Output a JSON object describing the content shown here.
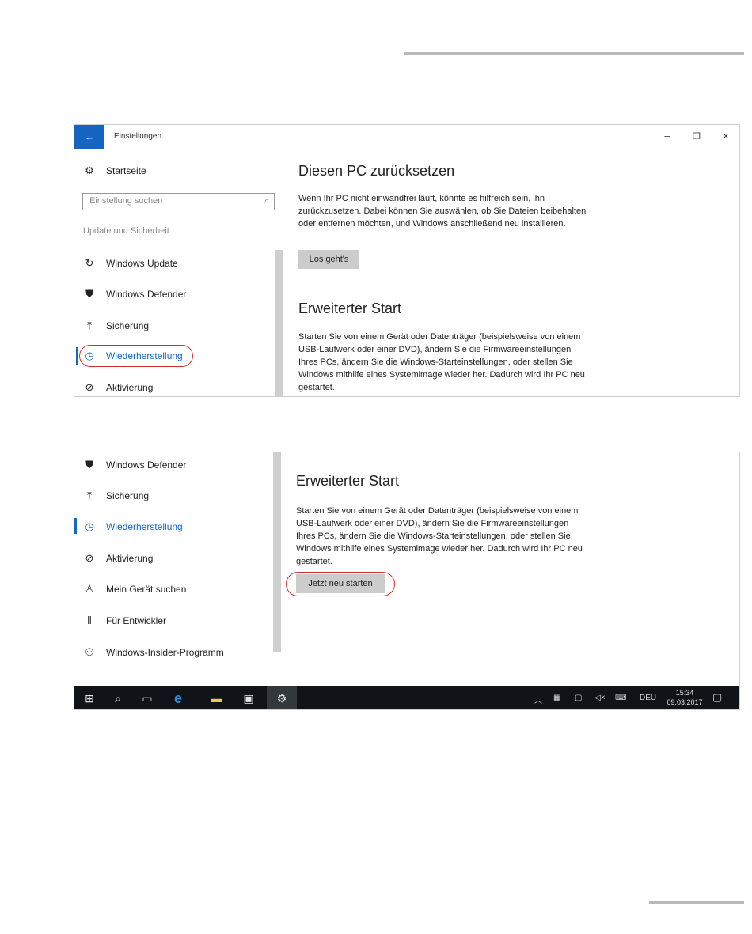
{
  "window": {
    "back_glyph": "←",
    "title": "Einstellungen",
    "minimize": "–",
    "maximize": "❐",
    "close": "✕"
  },
  "sidebar": {
    "home_label": "Startseite",
    "search_placeholder": "Einstellung suchen",
    "group_label": "Update und Sicherheit",
    "items": [
      {
        "label": "Windows Update",
        "icon": "refresh-icon"
      },
      {
        "label": "Windows Defender",
        "icon": "shield-icon"
      },
      {
        "label": "Sicherung",
        "icon": "backup-arrow-icon"
      },
      {
        "label": "Wiederherstellung",
        "icon": "history-icon"
      },
      {
        "label": "Aktivierung",
        "icon": "check-circle-icon"
      },
      {
        "label": "Mein Gerät suchen",
        "icon": "person-pin-icon"
      },
      {
        "label": "Für Entwickler",
        "icon": "tools-icon"
      },
      {
        "label": "Windows-Insider-Programm",
        "icon": "insider-icon"
      }
    ]
  },
  "reset": {
    "title": "Diesen PC zurücksetzen",
    "text": "Wenn Ihr PC nicht einwandfrei läuft, könnte es hilfreich sein, ihn zurückzusetzen. Dabei können Sie auswählen, ob Sie Dateien beibehalten oder entfernen möchten, und Windows anschließend neu installieren.",
    "button": "Los geht's"
  },
  "advanced": {
    "title": "Erweiterter Start",
    "text": "Starten Sie von einem Gerät oder Datenträger (beispielsweise von einem USB-Laufwerk oder einer DVD), ändern Sie die Firmwareeinstellungen Ihres PCs, ändern Sie die Windows-Starteinstellungen, oder stellen Sie Windows mithilfe eines Systemimage wieder her. Dadurch wird Ihr PC neu gestartet.",
    "button": "Jetzt neu starten"
  },
  "taskbar": {
    "lang": "DEU",
    "time": "15:34",
    "date": "09.03.2017"
  },
  "colors": {
    "accent": "#1a66c5",
    "highlight_oval": "#d32f2f",
    "taskbar": "#101418"
  }
}
